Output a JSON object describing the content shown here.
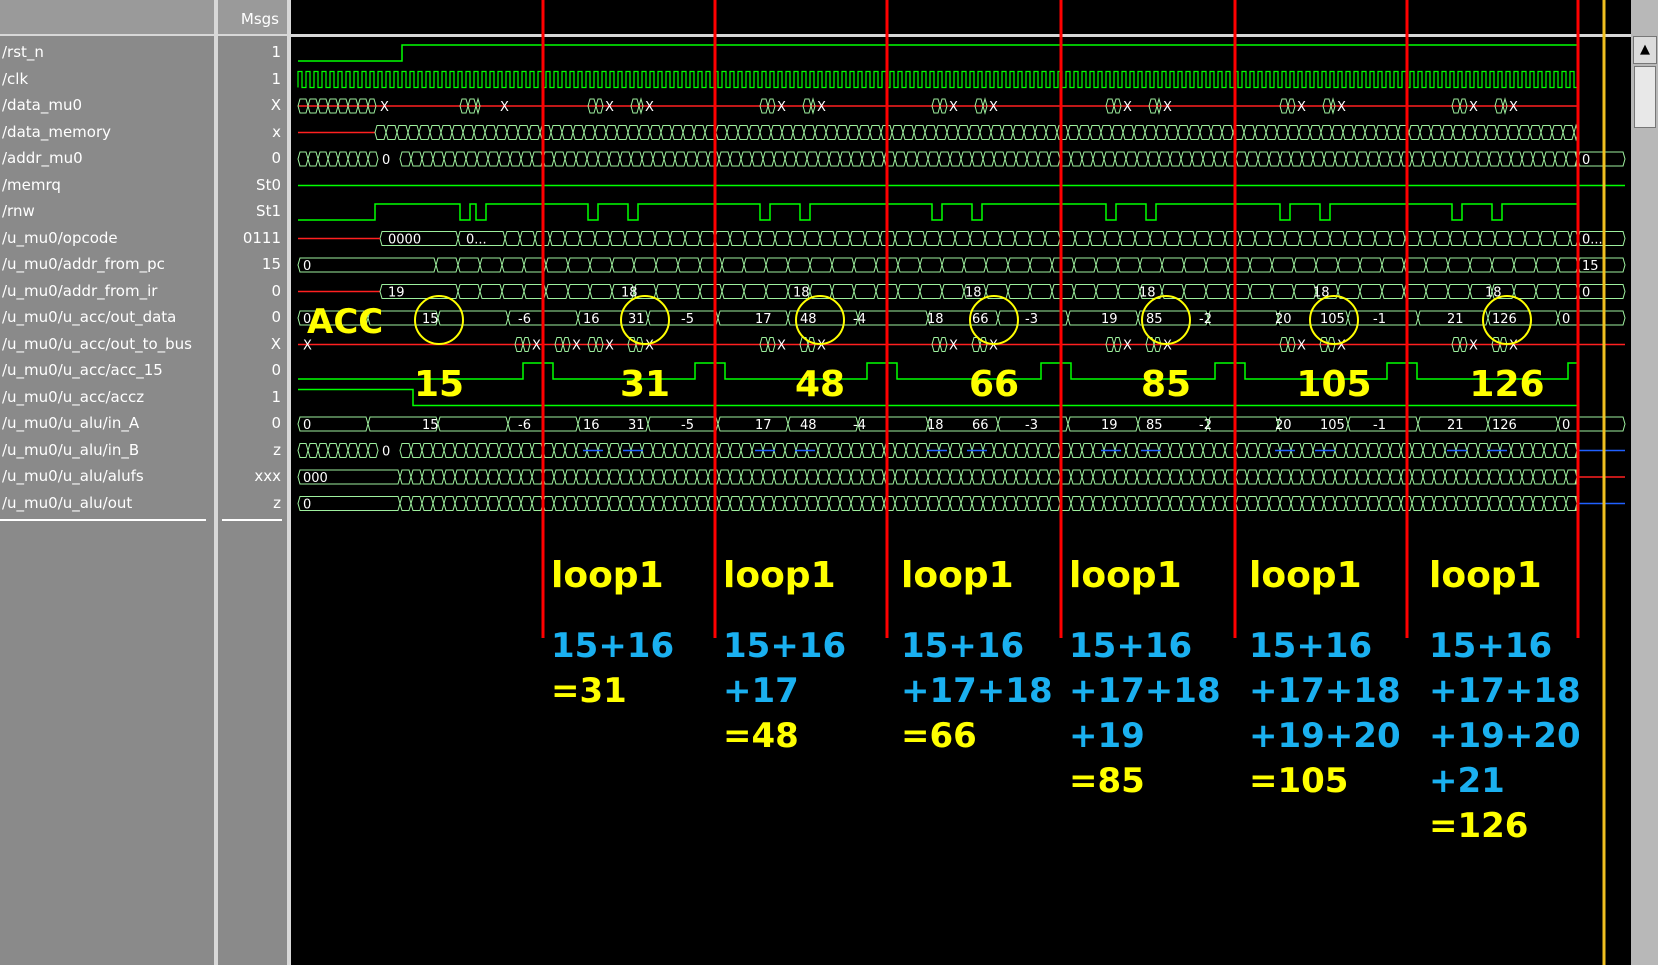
{
  "header": {
    "msgs_label": "Msgs"
  },
  "signals": [
    {
      "name": "/rst_n",
      "value": "1"
    },
    {
      "name": "/clk",
      "value": "1"
    },
    {
      "name": "/data_mu0",
      "value": "X"
    },
    {
      "name": "/data_memory",
      "value": "x"
    },
    {
      "name": "/addr_mu0",
      "value": "0"
    },
    {
      "name": "/memrq",
      "value": "St0"
    },
    {
      "name": "/rnw",
      "value": "St1"
    },
    {
      "name": "/u_mu0/opcode",
      "value": "0111"
    },
    {
      "name": "/u_mu0/addr_from_pc",
      "value": "15"
    },
    {
      "name": "/u_mu0/addr_from_ir",
      "value": "0"
    },
    {
      "name": "/u_mu0/u_acc/out_data",
      "value": "0"
    },
    {
      "name": "/u_mu0/u_acc/out_to_bus",
      "value": "X"
    },
    {
      "name": "/u_mu0/u_acc/acc_15",
      "value": "0"
    },
    {
      "name": "/u_mu0/u_acc/accz",
      "value": "1"
    },
    {
      "name": "/u_mu0/u_alu/in_A",
      "value": "0"
    },
    {
      "name": "/u_mu0/u_alu/in_B",
      "value": "z"
    },
    {
      "name": "/u_mu0/u_alu/alufs",
      "value": "xxx"
    },
    {
      "name": "/u_mu0/u_alu/out",
      "value": "z"
    }
  ],
  "wave_labels": {
    "opcode": [
      "0000",
      "0..."
    ],
    "opcode_end": "0...",
    "addr_from_pc": [
      "0"
    ],
    "addr_from_pc_end": "15",
    "addr_from_ir": [
      "19",
      "18",
      "18",
      "18",
      "18",
      "18",
      "18"
    ],
    "addr_from_ir_end": "0",
    "addr_mu0": [
      "0"
    ],
    "addr_mu0_end": "0",
    "data_mu0_x": "X",
    "out_to_bus_x": "X",
    "out_data_first": "0",
    "out_data_end": "0",
    "out_data": [
      {
        "acc": "15",
        "neg": "-6"
      },
      {
        "in": "16",
        "acc": "31",
        "neg": "-5"
      },
      {
        "in": "17",
        "acc": "48",
        "neg": "-4"
      },
      {
        "in": "18",
        "acc": "66",
        "neg": "-3"
      },
      {
        "in": "19",
        "acc": "85",
        "neg": "-2"
      },
      {
        "in": "20",
        "acc": "105",
        "neg": "-1"
      },
      {
        "in": "21",
        "acc": "126",
        "neg": ""
      }
    ],
    "in_A_first": "0",
    "in_A_end": "0",
    "in_B_first": "0",
    "alufs_first": "000",
    "alu_out_first": "0"
  },
  "annotations": {
    "acc_label": "ACC",
    "acc_values": [
      "15",
      "31",
      "48",
      "66",
      "85",
      "105",
      "126"
    ],
    "loop_label": "loop1",
    "sums": [
      {
        "lines": [
          "15+16"
        ],
        "result": "=31"
      },
      {
        "lines": [
          "15+16",
          "+17"
        ],
        "result": "=48"
      },
      {
        "lines": [
          "15+16",
          "+17+18"
        ],
        "result": "=66"
      },
      {
        "lines": [
          "15+16",
          "+17+18",
          "+19"
        ],
        "result": "=85"
      },
      {
        "lines": [
          "15+16",
          "+17+18",
          "+19+20"
        ],
        "result": "=105"
      },
      {
        "lines": [
          "15+16",
          "+17+18",
          "+19+20",
          "+21"
        ],
        "result": "=126"
      }
    ]
  },
  "colors": {
    "wave_green": "#00ff00",
    "bus_green": "#9ef09e",
    "x_red": "#ff2020",
    "z_blue": "#2060ff",
    "marker_red": "#ff0000",
    "cursor_yellow": "#f0c020",
    "anno_yellow": "#ffff00",
    "anno_cyan": "#1ab0f0",
    "label_white": "#ffffff"
  }
}
